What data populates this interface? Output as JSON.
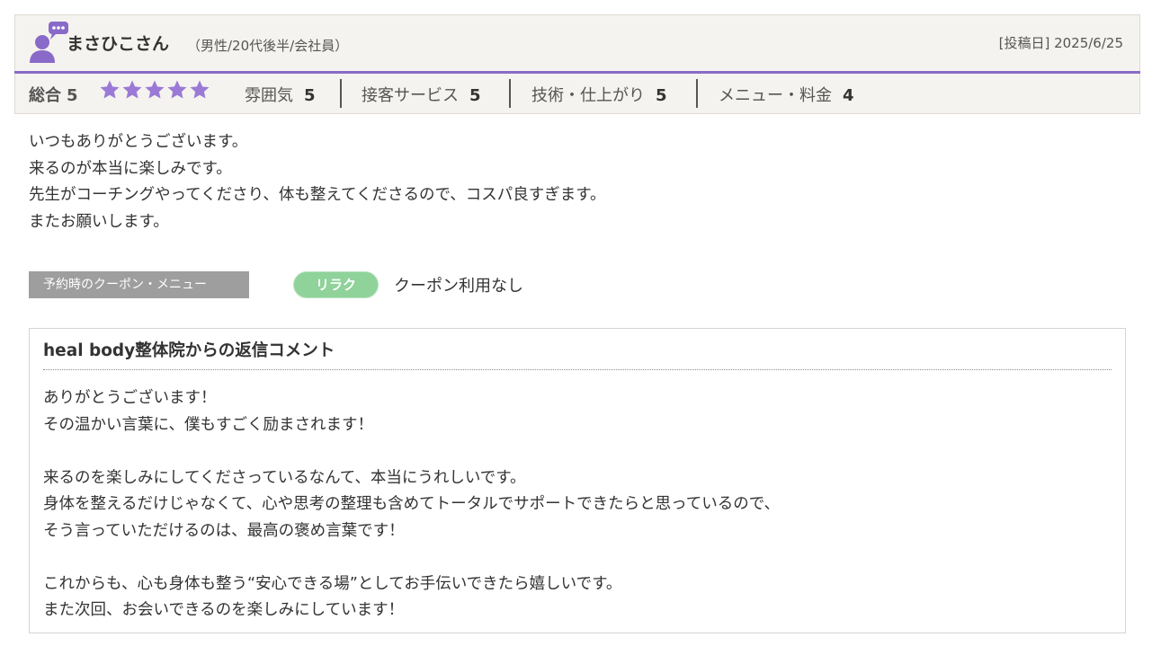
{
  "reviewer": {
    "name": "まさひこさん",
    "meta": "（男性/20代後半/会社員）",
    "post_date": "[投稿日] 2025/6/25"
  },
  "ratings": {
    "overall_label": "総合",
    "overall_score": "5",
    "stars_filled": 5,
    "stars_total": 5,
    "categories": [
      {
        "label": "雰囲気",
        "value": "5"
      },
      {
        "label": "接客サービス",
        "value": "5"
      },
      {
        "label": "技術・仕上がり",
        "value": "5"
      },
      {
        "label": "メニュー・料金",
        "value": "4"
      }
    ]
  },
  "review_lines": [
    "いつもありがとうございます。",
    "来るのが本当に楽しみです。",
    "先生がコーチングやってくださり、体も整えてくださるので、コスパ良すぎます。",
    "またお願いします。"
  ],
  "coupon": {
    "label": "予約時のクーポン・メニュー",
    "badge": "リラク",
    "value": "クーポン利用なし"
  },
  "reply": {
    "title": "heal body整体院からの返信コメント",
    "lines": [
      "ありがとうございます！",
      "その温かい言葉に、僕もすごく励まされます！",
      "",
      "来るのを楽しみにしてくださっているなんて、本当にうれしいです。",
      "身体を整えるだけじゃなくて、心や思考の整理も含めてトータルでサポートできたらと思っているので、",
      "そう言っていただけるのは、最高の褒め言葉です！",
      "",
      "これからも、心も身体も整う“安心できる場”としてお手伝いできたら嬉しいです。",
      "また次回、お会いできるのを楽しみにしています！"
    ]
  },
  "colors": {
    "accent_purple": "#8a6ac8",
    "star_purple": "#9a7ad6",
    "coupon_badge_green": "#8fd29a",
    "coupon_label_gray": "#9e9e9e",
    "header_bg": "#f5f3ef"
  },
  "icons": {
    "avatar": "user-comment-icon",
    "star": "star-icon"
  }
}
